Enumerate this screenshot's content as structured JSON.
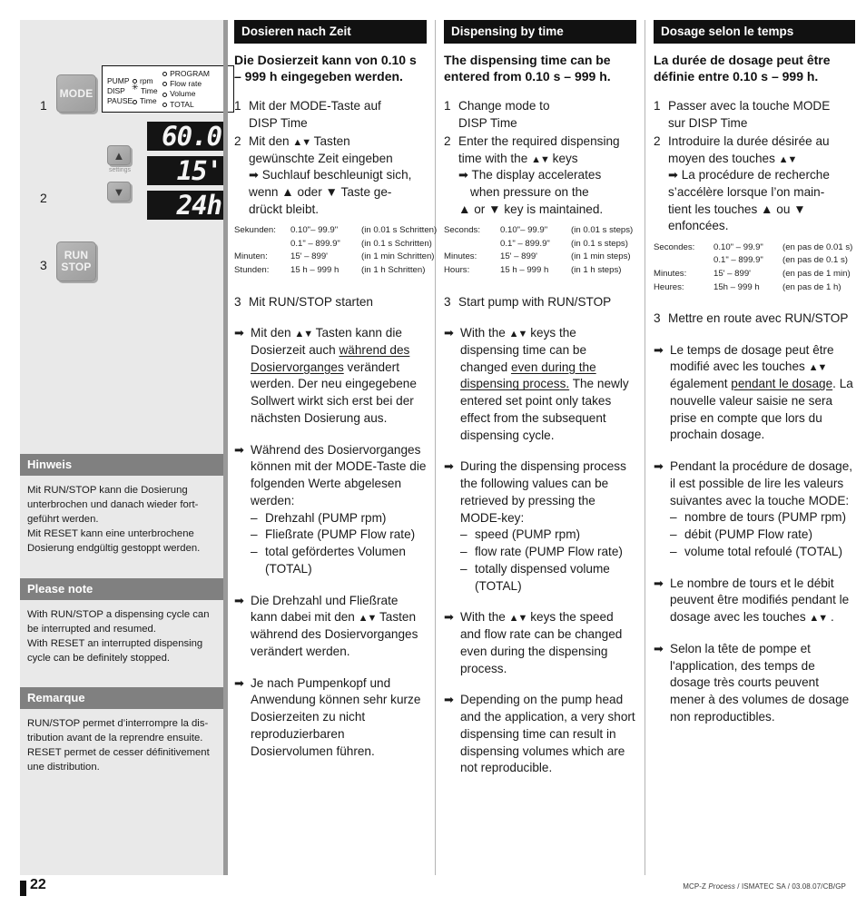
{
  "device": {
    "steps": {
      "one": "1",
      "two": "2",
      "three": "3"
    },
    "keys": {
      "mode": "MODE",
      "run": "RUN",
      "stop": "STOP",
      "up": "▲",
      "down": "▼",
      "settings_label": "settings"
    },
    "mode_matrix": {
      "left": [
        {
          "name": "PUMP",
          "led": "off",
          "label": "rpm"
        },
        {
          "name": "DISP",
          "led": "on",
          "label": "Time"
        },
        {
          "name": "PAUSE",
          "led": "off",
          "label": "Time"
        }
      ],
      "right": [
        {
          "led": "off",
          "label": "PROGRAM"
        },
        {
          "led": "off",
          "label": "Flow rate"
        },
        {
          "led": "off",
          "label": "Volume"
        },
        {
          "led": "off",
          "label": "TOTAL"
        }
      ]
    },
    "displays": [
      "60.0",
      "15'",
      "24h"
    ]
  },
  "notes": [
    {
      "title": "Hinweis",
      "lines": [
        "Mit RUN/STOP kann die Dosierung",
        "unterbrochen und danach wieder fort-",
        "geführt werden.",
        "Mit RESET kann eine unterbrochene",
        "Dosierung endgültig gestoppt werden."
      ]
    },
    {
      "title": "Please note",
      "lines": [
        "With RUN/STOP a dispensing cycle can",
        "be interrupted and resumed.",
        "With RESET an interrupted dispensing",
        "cycle can be definitely stopped."
      ]
    },
    {
      "title": "Remarque",
      "lines": [
        "RUN/STOP permet d’interrompre la dis-",
        "tribution avant de la reprendre ensuite.",
        "RESET permet de cesser définitivement",
        "une distribution."
      ]
    }
  ],
  "de": {
    "heading": "Dosieren nach Zeit",
    "lede": "Die Dosierzeit kann von 0.10 s – 999 h eingegeben werden.",
    "step1_num": "1",
    "step1_l1": "Mit der MODE-Taste auf",
    "step1_l2": "DISP Time",
    "step2_num": "2",
    "step2_a": "Mit den",
    "step2_b": "Tasten",
    "step2_l2": "gewünschte Zeit eingeben",
    "sub_l1": "Suchlauf beschleunigt sich,",
    "sub_l2_a": "wenn",
    "sub_l2_b": "oder",
    "sub_l2_c": "Taste ge-",
    "sub_l3": "drückt bleibt.",
    "spec": [
      {
        "label": "Sekunden:",
        "value": "0.10\"– 99.9\"",
        "step": "(in 0.01 s Schritten)"
      },
      {
        "label": "",
        "value": "0.1\" – 899.9\"",
        "step": "(in 0.1 s Schritten)"
      },
      {
        "label": "Minuten:",
        "value": "15' – 899'",
        "step": "(in 1 min Schritten)"
      },
      {
        "label": "Stunden:",
        "value": "15 h – 999 h",
        "step": "(in 1 h Schritten)"
      }
    ],
    "step3_num": "3",
    "step3_txt": "Mit RUN/STOP starten",
    "b1_a": "Mit den",
    "b1_b": "Tasten kann die Dosierzeit auch",
    "b1_u": "während des Dosiervorganges",
    "b1_c": "verändert werden. Der neu eingegebene Sollwert wirkt sich erst bei der nächsten Dosierung aus.",
    "b2_txt": "Während des Dosiervorganges können mit der MODE-Taste die folgenden Werte abgelesen werden:",
    "b2_items": [
      "Drehzahl (PUMP rpm)",
      "Fließrate (PUMP Flow rate)",
      "total gefördertes Volumen (TOTAL)"
    ],
    "b3_a": "Die Drehzahl und Fließrate kann dabei mit den",
    "b3_b": "Tasten während des Dosiervorganges verändert werden.",
    "b4_txt": "Je nach Pumpenkopf und Anwendung können sehr kurze Dosierzeiten zu nicht reproduzierbaren Dosiervolumen führen."
  },
  "en": {
    "heading": "Dispensing by time",
    "lede": "The dispensing time can be entered from 0.10 s – 999 h.",
    "step1_num": "1",
    "step1_l1": "Change mode to",
    "step1_l2": "DISP Time",
    "step2_num": "2",
    "step2_a": "Enter the required dispensing time with the",
    "step2_b": "keys",
    "sub_l1": "The display accelerates",
    "sub_l2": "when pressure on the",
    "sub_l3_a": "or",
    "sub_l3_b": "key is maintained.",
    "spec": [
      {
        "label": "Seconds:",
        "value": "0.10\"– 99.9\"",
        "step": "(in 0.01 s steps)"
      },
      {
        "label": "",
        "value": "0.1\" – 899.9\"",
        "step": "(in 0.1 s steps)"
      },
      {
        "label": "Minutes:",
        "value": "15' – 899'",
        "step": "(in 1 min steps)"
      },
      {
        "label": "Hours:",
        "value": "15 h – 999 h",
        "step": "(in 1 h steps)"
      }
    ],
    "step3_num": "3",
    "step3_txt": "Start pump with RUN/STOP",
    "b1_a": "With the",
    "b1_b": "keys the dispensing time can be changed",
    "b1_u": "even during the dispensing process.",
    "b1_c": "The newly entered set point only takes effect from the subsequent dispensing cycle.",
    "b2_txt": "During the dispensing process the following values can be retrieved by pressing the MODE-key:",
    "b2_items": [
      "speed (PUMP rpm)",
      "flow rate (PUMP Flow rate)",
      "totally dispensed volume (TOTAL)"
    ],
    "b3_a": "With the",
    "b3_b": "keys the speed and flow rate can be changed even during the dispensing process.",
    "b4_txt": "Depending on the pump head and the application, a very short dispensing time can result in dispensing volumes which are not reproducible."
  },
  "fr": {
    "heading": "Dosage selon le temps",
    "lede": "La durée de dosage peut être définie entre 0.10 s – 999 h.",
    "step1_num": "1",
    "step1_l1": "Passer avec la touche MODE",
    "step1_l2": "sur DISP Time",
    "step2_num": "2",
    "step2_a": "Introduire la durée désirée au moyen des touches",
    "sub_l1": "La procédure de recherche",
    "sub_l2": "s’accélère lorsque l’on main-",
    "sub_l3_a": "tient les touches",
    "sub_l3_b": "ou",
    "sub_l4": "enfoncées.",
    "spec": [
      {
        "label": "Secondes:",
        "value": "0.10\" – 99.9\"",
        "step": "(en pas de 0.01 s)"
      },
      {
        "label": "",
        "value": "0.1\" – 899.9\"",
        "step": "(en pas de 0.1 s)"
      },
      {
        "label": "Minutes:",
        "value": "15' – 899'",
        "step": "(en pas de 1 min)"
      },
      {
        "label": "Heures:",
        "value": "15h – 999 h",
        "step": "(en pas de 1 h)"
      }
    ],
    "step3_num": "3",
    "step3_txt": "Mettre en route avec RUN/STOP",
    "b1_a": "Le temps de dosage peut être modifié avec les touches",
    "b1_b": "également",
    "b1_u": "pendant le dosage",
    "b1_c": ". La nouvelle valeur saisie ne sera prise en compte que lors du prochain dosage.",
    "b2_txt": "Pendant la procédure de dosage, il est possible de lire les valeurs suivantes avec la touche MODE:",
    "b2_items": [
      "nombre de tours (PUMP rpm)",
      "débit (PUMP Flow rate)",
      "volume total refoulé (TOTAL)"
    ],
    "b3_a": "Le nombre de tours et le débit peuvent être modifiés pendant le dosage avec les touches",
    "b3_b": ".",
    "b4_txt": "Selon la tête de pompe et l'application, des temps de dosage très courts peuvent mener à des volumes de dosage non reproductibles."
  },
  "footer": {
    "page_number": "22",
    "imprint_a": "MCP-Z ",
    "imprint_b": "Process",
    "imprint_c": " / ISMATEC SA / 03.08.07/CB/GP"
  }
}
